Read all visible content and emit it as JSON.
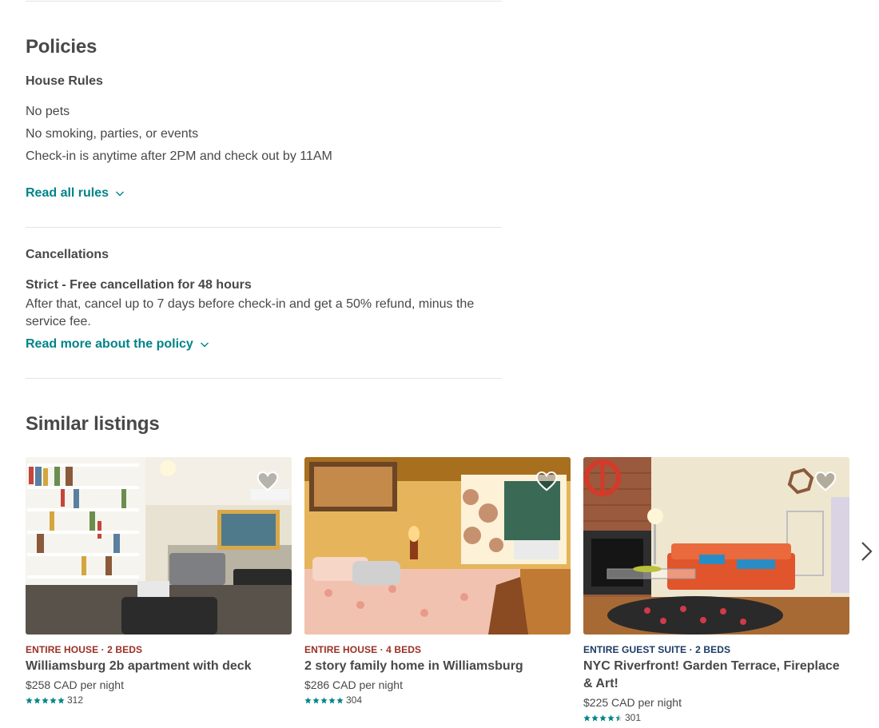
{
  "policies": {
    "heading": "Policies",
    "house_rules": {
      "heading": "House Rules",
      "rules": [
        "No pets",
        "No smoking, parties, or events",
        "Check-in is anytime after 2PM and check out by 11AM"
      ],
      "read_all": "Read all rules"
    },
    "cancellations": {
      "heading": "Cancellations",
      "policy_title": "Strict - Free cancellation for 48 hours",
      "policy_desc": "After that, cancel up to 7 days before check-in and get a 50% refund, minus the service fee.",
      "read_more": "Read more about the policy"
    }
  },
  "similar": {
    "heading": "Similar listings",
    "listings": [
      {
        "kicker": "Entire house · 2 beds",
        "kicker_color": "#9b2f24",
        "title": "Williamsburg 2b apartment with deck",
        "price": "$258 CAD per night",
        "stars": 5,
        "reviews": "312"
      },
      {
        "kicker": "Entire house · 4 beds",
        "kicker_color": "#9b2f24",
        "title": "2 story family home in Williamsburg",
        "price": "$286 CAD per night",
        "stars": 5,
        "reviews": "304"
      },
      {
        "kicker": "Entire guest suite · 2 beds",
        "kicker_color": "#1b3a66",
        "title": "NYC Riverfront! Garden Terrace, Fireplace & Art!",
        "price": "$225 CAD per night",
        "stars": 4.5,
        "reviews": "301"
      }
    ]
  },
  "colors": {
    "accent": "#008489",
    "text": "#484848",
    "star": "#008489"
  }
}
